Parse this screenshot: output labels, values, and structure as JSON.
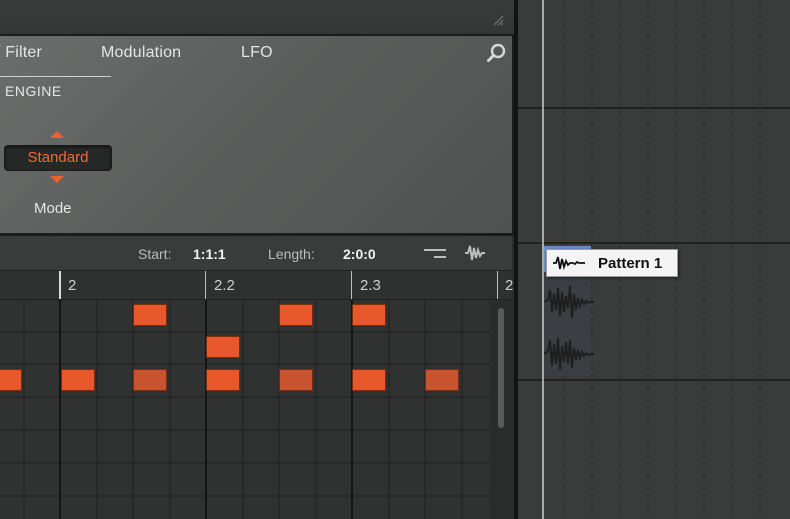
{
  "plugin": {
    "tabs": [
      {
        "label": "/ Filter"
      },
      {
        "label": "Modulation"
      },
      {
        "label": "LFO"
      }
    ],
    "section_label": "ENGINE",
    "mode": {
      "value": "Standard",
      "label": "Mode"
    }
  },
  "editor": {
    "start_label": "Start:",
    "start_value": "1:1:1",
    "length_label": "Length:",
    "length_value": "2:0:0",
    "ruler": [
      "2",
      "2.2",
      "2.3",
      "2"
    ]
  },
  "arranger": {
    "pattern_name": "Pattern 1"
  },
  "colors": {
    "accent": "#e8582a",
    "accent_text": "#f26a33",
    "clip_header": "#6a8fc8"
  },
  "icons": {
    "search": "search-icon",
    "quantize": "quantize-icon",
    "waveform": "waveform-icon",
    "resize": "resize-grip-icon"
  }
}
